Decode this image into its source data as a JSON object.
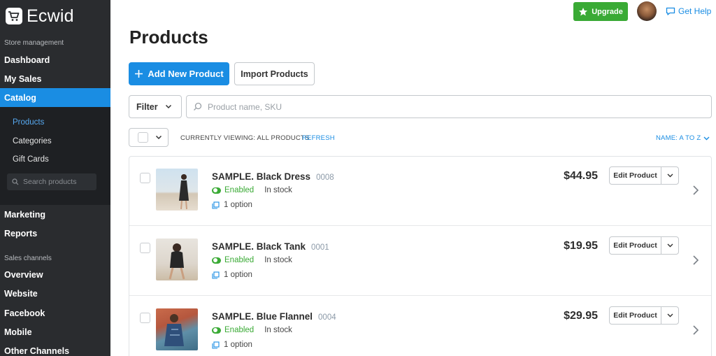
{
  "brand": {
    "name": "Ecwid"
  },
  "sidebar": {
    "store_section": "Store management",
    "items_top": [
      "Dashboard",
      "My Sales",
      "Catalog"
    ],
    "catalog_sub": [
      "Products",
      "Categories",
      "Gift Cards"
    ],
    "search_placeholder": "Search products",
    "items_mid": [
      "Marketing",
      "Reports"
    ],
    "channels_section": "Sales channels",
    "channels": [
      "Overview",
      "Website",
      "Facebook",
      "Mobile",
      "Other Channels"
    ]
  },
  "header": {
    "upgrade": "Upgrade",
    "get_help": "Get Help"
  },
  "page": {
    "title": "Products"
  },
  "actions": {
    "add": "Add New Product",
    "import": "Import Products"
  },
  "toolbar": {
    "filter": "Filter",
    "search_placeholder": "Product name, SKU"
  },
  "viewing": {
    "label": "CURRENTLY VIEWING: ALL PRODUCTS",
    "refresh": "REFRESH",
    "sort": "NAME: A TO Z"
  },
  "products": [
    {
      "name": "SAMPLE. Black Dress",
      "sku": "0008",
      "status": "Enabled",
      "stock": "In stock",
      "options": "1 option",
      "price": "$44.95",
      "edit": "Edit Product"
    },
    {
      "name": "SAMPLE. Black Tank",
      "sku": "0001",
      "status": "Enabled",
      "stock": "In stock",
      "options": "1 option",
      "price": "$19.95",
      "edit": "Edit Product"
    },
    {
      "name": "SAMPLE. Blue Flannel",
      "sku": "0004",
      "status": "Enabled",
      "stock": "In stock",
      "options": "1 option",
      "price": "$29.95",
      "edit": "Edit Product"
    }
  ],
  "colors": {
    "accent": "#1a8de3",
    "success": "#3aaa35",
    "sidebar": "#2a2c2f"
  }
}
